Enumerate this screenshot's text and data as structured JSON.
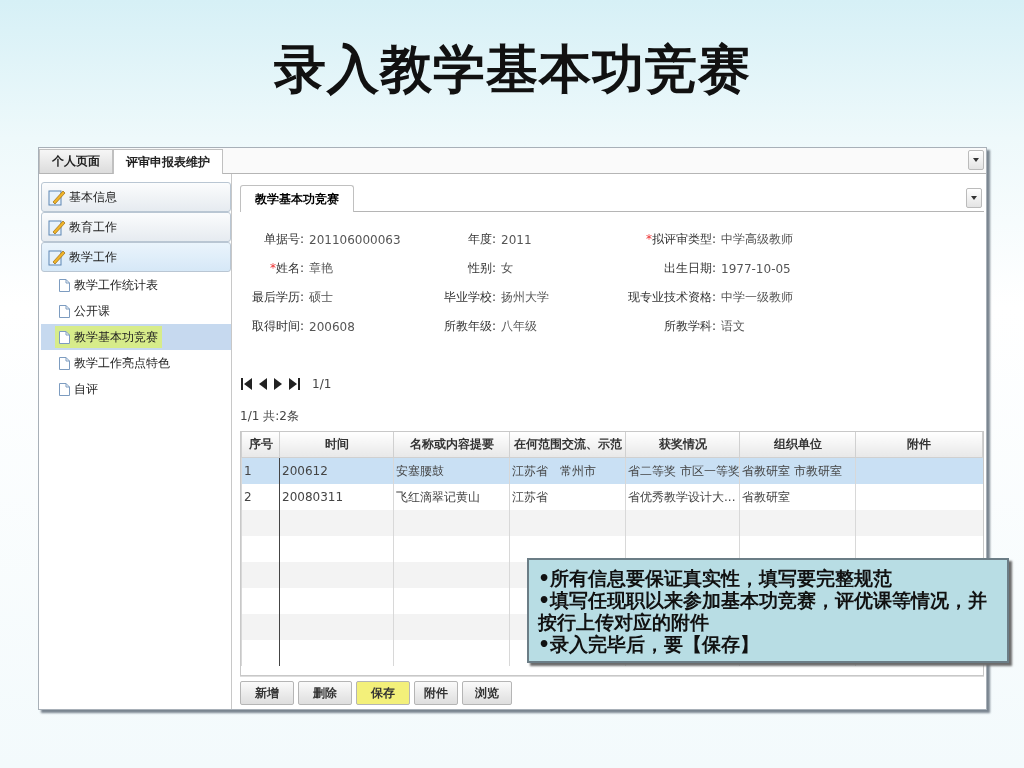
{
  "slide_title": "录入教学基本功竞赛",
  "tabs": [
    {
      "label": "个人页面",
      "selected": false
    },
    {
      "label": "评审申报表维护",
      "selected": true
    }
  ],
  "sidebar": {
    "groups": [
      {
        "label": "基本信息",
        "expanded": false
      },
      {
        "label": "教育工作",
        "expanded": false
      },
      {
        "label": "教学工作",
        "expanded": true,
        "children": [
          {
            "label": "教学工作统计表",
            "selected": false
          },
          {
            "label": "公开课",
            "selected": false
          },
          {
            "label": "教学基本功竞赛",
            "selected": true
          },
          {
            "label": "教学工作亮点特色",
            "selected": false
          },
          {
            "label": "自评",
            "selected": false
          }
        ]
      }
    ]
  },
  "panel_tabs": [
    {
      "label": "教学基本功竞赛",
      "selected": true
    }
  ],
  "form": [
    {
      "label": "单据号:",
      "value": "201106000063"
    },
    {
      "label": "年度:",
      "value": "2011"
    },
    {
      "label": "拟评审类型:",
      "value": "中学高级教师",
      "required_mark": "*"
    },
    {
      "label": "姓名:",
      "value": "章艳",
      "required_mark": "*"
    },
    {
      "label": "性别:",
      "value": "女"
    },
    {
      "label": "出生日期:",
      "value": "1977-10-05"
    },
    {
      "label": "最后学历:",
      "value": "硕士"
    },
    {
      "label": "毕业学校:",
      "value": "扬州大学"
    },
    {
      "label": "现专业技术资格:",
      "value": "中学一级教师"
    },
    {
      "label": "取得时间:",
      "value": "200608"
    },
    {
      "label": "所教年级:",
      "value": "八年级"
    },
    {
      "label": "所教学科:",
      "value": "语文"
    }
  ],
  "pager": {
    "page": "1/1",
    "summary": "1/1 共:2条"
  },
  "table": {
    "columns": [
      "序号",
      "时间",
      "名称或内容提要",
      "在何范围交流、示范",
      "获奖情况",
      "组织单位",
      "附件"
    ],
    "rows": [
      {
        "selected": true,
        "cells": [
          "1",
          "200612",
          "安塞腰鼓",
          "江苏省　常州市",
          "省二等奖 市区一等奖",
          "省教研室 市教研室",
          ""
        ]
      },
      {
        "selected": false,
        "cells": [
          "2",
          "20080311",
          "飞红滴翠记黄山",
          "江苏省",
          "省优秀教学设计大...",
          "省教研室",
          ""
        ]
      }
    ]
  },
  "buttons": [
    {
      "label": "新增",
      "highlighted": false
    },
    {
      "label": "删除",
      "highlighted": false
    },
    {
      "label": "保存",
      "highlighted": true
    },
    {
      "label": "附件",
      "highlighted": false
    },
    {
      "label": "浏览",
      "highlighted": false
    }
  ],
  "callout": [
    "•所有信息要保证真实性，填写要完整规范",
    "•填写任现职以来参加基本功竞赛，评优课等情况，并按行上传对应的附件",
    "•录入完毕后，要【保存】"
  ]
}
